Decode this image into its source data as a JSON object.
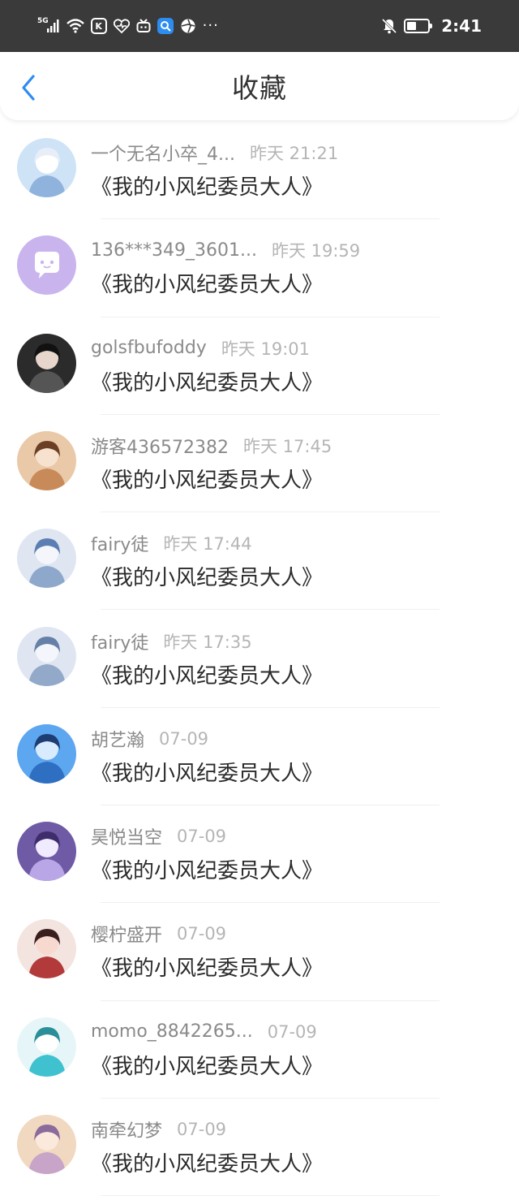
{
  "status_bar": {
    "signal": "5G",
    "time": "2:41",
    "battery_level": 0.45,
    "more": "···"
  },
  "header": {
    "title": "收藏"
  },
  "items": [
    {
      "name": "一个无名小卒_4...",
      "time": "昨天 21:21",
      "title": "《我的小风纪委员大人》"
    },
    {
      "name": "136***349_3601...",
      "time": "昨天 19:59",
      "title": "《我的小风纪委员大人》"
    },
    {
      "name": "golsfbufoddy",
      "time": "昨天 19:01",
      "title": "《我的小风纪委员大人》"
    },
    {
      "name": "游客436572382",
      "time": "昨天 17:45",
      "title": "《我的小风纪委员大人》"
    },
    {
      "name": "fairy徒",
      "time": "昨天 17:44",
      "title": "《我的小风纪委员大人》"
    },
    {
      "name": "fairy徒",
      "time": "昨天 17:35",
      "title": "《我的小风纪委员大人》"
    },
    {
      "name": "胡艺瀚",
      "time": "07-09",
      "title": "《我的小风纪委员大人》"
    },
    {
      "name": "昊悦当空",
      "time": "07-09",
      "title": "《我的小风纪委员大人》"
    },
    {
      "name": "樱柠盛开",
      "time": "07-09",
      "title": "《我的小风纪委员大人》"
    },
    {
      "name": "momo_8842265...",
      "time": "07-09",
      "title": "《我的小风纪委员大人》"
    },
    {
      "name": "南牵幻梦",
      "time": "07-09",
      "title": "《我的小风纪委员大人》"
    }
  ],
  "colors": {
    "status_bar_bg": "#3a3a3a",
    "accent": "#2d8cf0",
    "name_text": "#8a8a8a",
    "time_text": "#b5b5b5",
    "title_text": "#2b2b2b"
  }
}
